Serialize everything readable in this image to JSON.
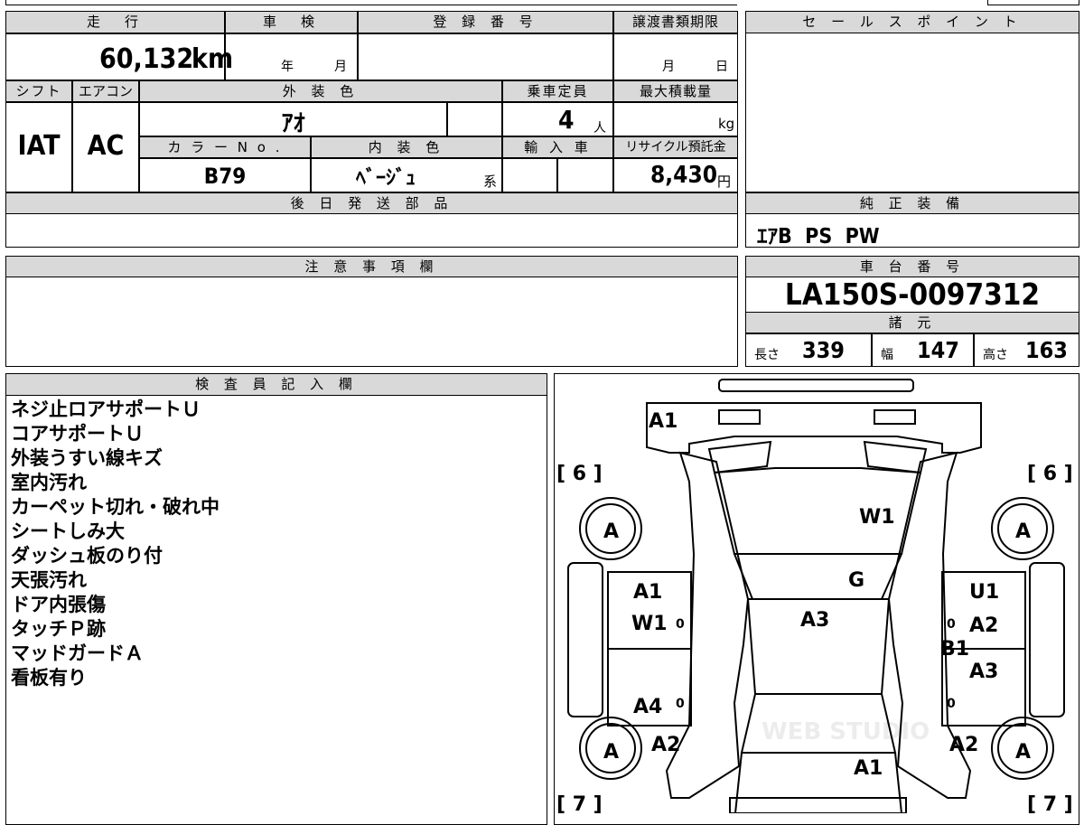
{
  "top_row": {
    "mileage": {
      "label": "走　行",
      "value": "60,132",
      "unit": "km"
    },
    "inspection": {
      "label": "車　検",
      "year_label": "年",
      "month_label": "月"
    },
    "registration": {
      "label": "登 録 番 号",
      "value": ""
    },
    "transfer_deadline": {
      "label": "譲渡書類期限",
      "month_label": "月",
      "day_label": "日"
    }
  },
  "second_row": {
    "shift": {
      "label": "シフト",
      "value": "IAT"
    },
    "aircon": {
      "label": "エアコン",
      "value": "AC"
    },
    "exterior_color": {
      "label": "外 装 色",
      "value": "ｱｵ"
    },
    "capacity": {
      "label": "乗車定員",
      "value": "4",
      "unit": "人"
    },
    "max_load": {
      "label": "最大積載量",
      "value": "",
      "unit": "kg"
    },
    "color_no": {
      "label": "カ ラ ー N o .",
      "value": "B79"
    },
    "interior_color": {
      "label": "内 装 色",
      "value": "ﾍﾞｰｼﾞｭ",
      "suffix": "系"
    },
    "import": {
      "label": "輸 入 車",
      "value": ""
    },
    "recycle": {
      "label": "リサイクル預託金",
      "value": "8,430",
      "unit": "円"
    }
  },
  "later_parts": {
    "label": "後 日 発 送 部 品",
    "value": ""
  },
  "caution": {
    "label": "注 意 事 項 欄",
    "value": ""
  },
  "sales_point": {
    "label": "セ ー ル ス ポ イ ン ト",
    "value": ""
  },
  "genuine_equipment": {
    "label": "純 正 装 備",
    "value": "ｴｱB  PS  PW"
  },
  "chassis": {
    "label": "車 台 番 号",
    "value": "LA150S-0097312"
  },
  "specs": {
    "label": "諸 元",
    "length_label": "長さ",
    "length": "339",
    "width_label": "幅",
    "width": "147",
    "height_label": "高さ",
    "height": "163"
  },
  "inspector": {
    "label": "検 査 員 記 入 欄",
    "notes": [
      "ネジ止ロアサポートＵ",
      "コアサポートＵ",
      "外装うすい線キズ",
      "室内汚れ",
      "カーペット切れ・破れ中",
      "シートしみ大",
      "ダッシュ板のり付",
      "天張汚れ",
      "ドア内張傷",
      "タッチＰ跡",
      "マッドガードＡ",
      "看板有り"
    ]
  },
  "diagram": {
    "tire_counts": {
      "front_left": "[ 6 ]",
      "front_right": "[ 6 ]",
      "rear_left": "[ 7 ]",
      "rear_right": "[ 7 ]"
    },
    "wheel_marks": {
      "front_left": "A",
      "front_right": "A",
      "rear_left": "A",
      "rear_right": "A"
    },
    "marks": {
      "front_bumper": "A1",
      "windshield": "W1",
      "hood_seam": "G",
      "left_front_door_1": "A1",
      "left_front_door_2": "W1",
      "left_rear_door": "A4",
      "left_rear_fender": "A2",
      "right_front_door_1": "U1",
      "right_front_door_2": "A2",
      "right_rear_door_1": "B1",
      "right_rear_door_2": "A3",
      "right_rear_fender": "A2",
      "roof": "A3",
      "rear": "A1"
    },
    "watermark": "WEB STUDIO"
  }
}
